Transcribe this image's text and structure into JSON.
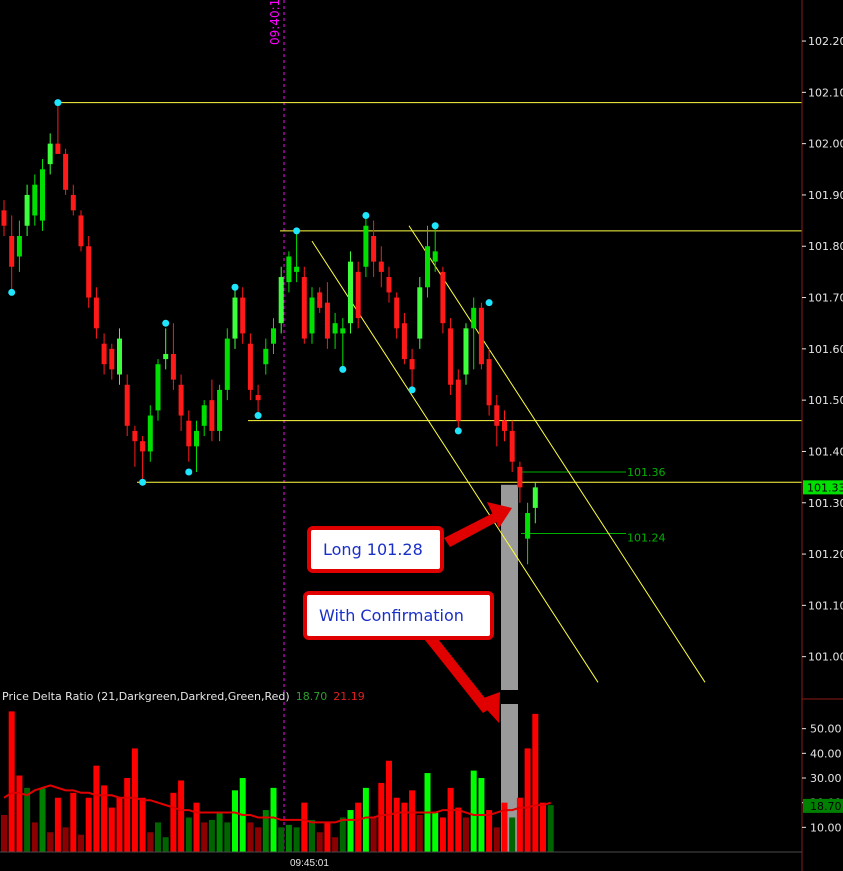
{
  "chart_data": {
    "type": "candlestick",
    "price_axis": {
      "range": [
        100.935,
        102.28
      ],
      "ticks": [
        "102.20",
        "102.10",
        "102.00",
        "101.90",
        "101.80",
        "101.70",
        "101.60",
        "101.50",
        "101.40",
        "101.30",
        "101.20",
        "101.10",
        "101.00"
      ],
      "current_price": "101.33"
    },
    "time_labels": {
      "marker": "09:40:1",
      "bottom": "09:45:01"
    },
    "horizontal_levels": [
      102.08,
      101.83,
      101.46,
      101.34
    ],
    "range_markers": {
      "upper": "101.36",
      "lower": "101.24",
      "upper_value": 101.36,
      "lower_value": 101.24
    },
    "candles": [
      {
        "o": 101.87,
        "h": 101.89,
        "l": 101.82,
        "c": 101.84,
        "d": "down"
      },
      {
        "o": 101.82,
        "h": 101.86,
        "l": 101.71,
        "c": 101.76,
        "d": "down"
      },
      {
        "o": 101.78,
        "h": 101.85,
        "l": 101.75,
        "c": 101.82,
        "d": "up"
      },
      {
        "o": 101.84,
        "h": 101.92,
        "l": 101.82,
        "c": 101.9,
        "d": "up"
      },
      {
        "o": 101.86,
        "h": 101.94,
        "l": 101.84,
        "c": 101.92,
        "d": "up"
      },
      {
        "o": 101.85,
        "h": 101.97,
        "l": 101.83,
        "c": 101.95,
        "d": "up"
      },
      {
        "o": 101.96,
        "h": 102.02,
        "l": 101.94,
        "c": 102.0,
        "d": "up"
      },
      {
        "o": 102.0,
        "h": 102.08,
        "l": 101.98,
        "c": 101.98,
        "d": "down"
      },
      {
        "o": 101.98,
        "h": 101.99,
        "l": 101.9,
        "c": 101.91,
        "d": "down"
      },
      {
        "o": 101.9,
        "h": 101.92,
        "l": 101.86,
        "c": 101.87,
        "d": "down"
      },
      {
        "o": 101.86,
        "h": 101.87,
        "l": 101.79,
        "c": 101.8,
        "d": "down"
      },
      {
        "o": 101.8,
        "h": 101.82,
        "l": 101.68,
        "c": 101.7,
        "d": "down"
      },
      {
        "o": 101.7,
        "h": 101.72,
        "l": 101.62,
        "c": 101.64,
        "d": "down"
      },
      {
        "o": 101.61,
        "h": 101.63,
        "l": 101.55,
        "c": 101.57,
        "d": "down"
      },
      {
        "o": 101.6,
        "h": 101.61,
        "l": 101.54,
        "c": 101.56,
        "d": "down"
      },
      {
        "o": 101.55,
        "h": 101.64,
        "l": 101.53,
        "c": 101.62,
        "d": "up"
      },
      {
        "o": 101.53,
        "h": 101.55,
        "l": 101.43,
        "c": 101.45,
        "d": "down"
      },
      {
        "o": 101.44,
        "h": 101.45,
        "l": 101.37,
        "c": 101.42,
        "d": "down"
      },
      {
        "o": 101.42,
        "h": 101.43,
        "l": 101.34,
        "c": 101.4,
        "d": "down"
      },
      {
        "o": 101.4,
        "h": 101.49,
        "l": 101.38,
        "c": 101.47,
        "d": "up"
      },
      {
        "o": 101.48,
        "h": 101.58,
        "l": 101.46,
        "c": 101.57,
        "d": "up"
      },
      {
        "o": 101.58,
        "h": 101.64,
        "l": 101.56,
        "c": 101.59,
        "d": "up"
      },
      {
        "o": 101.59,
        "h": 101.65,
        "l": 101.52,
        "c": 101.54,
        "d": "down"
      },
      {
        "o": 101.53,
        "h": 101.55,
        "l": 101.44,
        "c": 101.47,
        "d": "down"
      },
      {
        "o": 101.46,
        "h": 101.48,
        "l": 101.38,
        "c": 101.41,
        "d": "down"
      },
      {
        "o": 101.41,
        "h": 101.46,
        "l": 101.36,
        "c": 101.44,
        "d": "up"
      },
      {
        "o": 101.45,
        "h": 101.5,
        "l": 101.43,
        "c": 101.49,
        "d": "up"
      },
      {
        "o": 101.5,
        "h": 101.54,
        "l": 101.42,
        "c": 101.44,
        "d": "down"
      },
      {
        "o": 101.44,
        "h": 101.53,
        "l": 101.42,
        "c": 101.52,
        "d": "up"
      },
      {
        "o": 101.52,
        "h": 101.64,
        "l": 101.5,
        "c": 101.62,
        "d": "up"
      },
      {
        "o": 101.62,
        "h": 101.72,
        "l": 101.6,
        "c": 101.7,
        "d": "up"
      },
      {
        "o": 101.7,
        "h": 101.72,
        "l": 101.61,
        "c": 101.63,
        "d": "down"
      },
      {
        "o": 101.61,
        "h": 101.63,
        "l": 101.5,
        "c": 101.52,
        "d": "down"
      },
      {
        "o": 101.51,
        "h": 101.53,
        "l": 101.47,
        "c": 101.5,
        "d": "down"
      },
      {
        "o": 101.57,
        "h": 101.62,
        "l": 101.55,
        "c": 101.6,
        "d": "up"
      },
      {
        "o": 101.61,
        "h": 101.66,
        "l": 101.59,
        "c": 101.64,
        "d": "up"
      },
      {
        "o": 101.65,
        "h": 101.76,
        "l": 101.63,
        "c": 101.74,
        "d": "up"
      },
      {
        "o": 101.73,
        "h": 101.79,
        "l": 101.71,
        "c": 101.78,
        "d": "up"
      },
      {
        "o": 101.76,
        "h": 101.83,
        "l": 101.73,
        "c": 101.75,
        "d": "up"
      },
      {
        "o": 101.74,
        "h": 101.76,
        "l": 101.61,
        "c": 101.62,
        "d": "down"
      },
      {
        "o": 101.63,
        "h": 101.72,
        "l": 101.61,
        "c": 101.7,
        "d": "up"
      },
      {
        "o": 101.71,
        "h": 101.72,
        "l": 101.67,
        "c": 101.68,
        "d": "down"
      },
      {
        "o": 101.69,
        "h": 101.73,
        "l": 101.6,
        "c": 101.62,
        "d": "down"
      },
      {
        "o": 101.63,
        "h": 101.67,
        "l": 101.6,
        "c": 101.65,
        "d": "up"
      },
      {
        "o": 101.64,
        "h": 101.66,
        "l": 101.56,
        "c": 101.63,
        "d": "up"
      },
      {
        "o": 101.65,
        "h": 101.79,
        "l": 101.63,
        "c": 101.77,
        "d": "up"
      },
      {
        "o": 101.75,
        "h": 101.77,
        "l": 101.64,
        "c": 101.66,
        "d": "down"
      },
      {
        "o": 101.76,
        "h": 101.86,
        "l": 101.74,
        "c": 101.84,
        "d": "up"
      },
      {
        "o": 101.82,
        "h": 101.85,
        "l": 101.74,
        "c": 101.77,
        "d": "down"
      },
      {
        "o": 101.77,
        "h": 101.8,
        "l": 101.72,
        "c": 101.75,
        "d": "down"
      },
      {
        "o": 101.74,
        "h": 101.76,
        "l": 101.69,
        "c": 101.71,
        "d": "down"
      },
      {
        "o": 101.7,
        "h": 101.71,
        "l": 101.62,
        "c": 101.64,
        "d": "down"
      },
      {
        "o": 101.65,
        "h": 101.67,
        "l": 101.57,
        "c": 101.58,
        "d": "down"
      },
      {
        "o": 101.58,
        "h": 101.6,
        "l": 101.52,
        "c": 101.56,
        "d": "down"
      },
      {
        "o": 101.62,
        "h": 101.74,
        "l": 101.6,
        "c": 101.72,
        "d": "up"
      },
      {
        "o": 101.72,
        "h": 101.84,
        "l": 101.7,
        "c": 101.8,
        "d": "up"
      },
      {
        "o": 101.77,
        "h": 101.84,
        "l": 101.75,
        "c": 101.79,
        "d": "up"
      },
      {
        "o": 101.75,
        "h": 101.76,
        "l": 101.63,
        "c": 101.65,
        "d": "down"
      },
      {
        "o": 101.64,
        "h": 101.66,
        "l": 101.51,
        "c": 101.53,
        "d": "down"
      },
      {
        "o": 101.54,
        "h": 101.56,
        "l": 101.44,
        "c": 101.46,
        "d": "down"
      },
      {
        "o": 101.55,
        "h": 101.65,
        "l": 101.53,
        "c": 101.64,
        "d": "up"
      },
      {
        "o": 101.64,
        "h": 101.7,
        "l": 101.56,
        "c": 101.68,
        "d": "up"
      },
      {
        "o": 101.68,
        "h": 101.69,
        "l": 101.56,
        "c": 101.57,
        "d": "down"
      },
      {
        "o": 101.58,
        "h": 101.6,
        "l": 101.47,
        "c": 101.49,
        "d": "down"
      },
      {
        "o": 101.49,
        "h": 101.51,
        "l": 101.41,
        "c": 101.45,
        "d": "down"
      },
      {
        "o": 101.46,
        "h": 101.48,
        "l": 101.42,
        "c": 101.44,
        "d": "down"
      },
      {
        "o": 101.44,
        "h": 101.46,
        "l": 101.36,
        "c": 101.38,
        "d": "down"
      },
      {
        "o": 101.37,
        "h": 101.38,
        "l": 101.3,
        "c": 101.33,
        "d": "down"
      },
      {
        "o": 101.23,
        "h": 101.3,
        "l": 101.18,
        "c": 101.28,
        "d": "up"
      },
      {
        "o": 101.29,
        "h": 101.34,
        "l": 101.26,
        "c": 101.33,
        "d": "up"
      }
    ],
    "swing_points": [
      {
        "i": 1,
        "v": 101.71
      },
      {
        "i": 7,
        "v": 102.08
      },
      {
        "i": 18,
        "v": 101.34
      },
      {
        "i": 21,
        "v": 101.65
      },
      {
        "i": 24,
        "v": 101.36
      },
      {
        "i": 30,
        "v": 101.72
      },
      {
        "i": 33,
        "v": 101.47
      },
      {
        "i": 38,
        "v": 101.83
      },
      {
        "i": 44,
        "v": 101.56
      },
      {
        "i": 47,
        "v": 101.86
      },
      {
        "i": 53,
        "v": 101.52
      },
      {
        "i": 56,
        "v": 101.84
      },
      {
        "i": 59,
        "v": 101.44
      },
      {
        "i": 63,
        "v": 101.69
      }
    ],
    "indicator": {
      "title": "Price Delta Ratio (21,Darkgreen,Darkred,Green,Red)",
      "value_green": "18.70",
      "value_red": "21.19",
      "axis_ticks": [
        "50.00",
        "40.00",
        "30.00",
        "20.00",
        "10.00"
      ],
      "axis_range": [
        0,
        60
      ],
      "current_label": "18.70",
      "bars": [
        {
          "v": 15,
          "c": "#8b0000"
        },
        {
          "v": 57,
          "c": "#ff0000"
        },
        {
          "v": 31,
          "c": "#ff0000"
        },
        {
          "v": 26,
          "c": "#006400"
        },
        {
          "v": 12,
          "c": "#8b0000"
        },
        {
          "v": 26,
          "c": "#008000"
        },
        {
          "v": 8,
          "c": "#8b0000"
        },
        {
          "v": 22,
          "c": "#ff0000"
        },
        {
          "v": 10,
          "c": "#8b0000"
        },
        {
          "v": 24,
          "c": "#ff0000"
        },
        {
          "v": 7,
          "c": "#8b0000"
        },
        {
          "v": 22,
          "c": "#ff0000"
        },
        {
          "v": 35,
          "c": "#ff0000"
        },
        {
          "v": 27,
          "c": "#ff0000"
        },
        {
          "v": 18,
          "c": "#ff0000"
        },
        {
          "v": 22,
          "c": "#ff0000"
        },
        {
          "v": 30,
          "c": "#ff0000"
        },
        {
          "v": 42,
          "c": "#ff0000"
        },
        {
          "v": 22,
          "c": "#ff0000"
        },
        {
          "v": 8,
          "c": "#8b0000"
        },
        {
          "v": 12,
          "c": "#006400"
        },
        {
          "v": 6,
          "c": "#006400"
        },
        {
          "v": 24,
          "c": "#ff0000"
        },
        {
          "v": 29,
          "c": "#ff0000"
        },
        {
          "v": 14,
          "c": "#006400"
        },
        {
          "v": 20,
          "c": "#ff0000"
        },
        {
          "v": 12,
          "c": "#8b0000"
        },
        {
          "v": 13,
          "c": "#006400"
        },
        {
          "v": 16,
          "c": "#008000"
        },
        {
          "v": 12,
          "c": "#006400"
        },
        {
          "v": 25,
          "c": "#00ff00"
        },
        {
          "v": 30,
          "c": "#00ff00"
        },
        {
          "v": 12,
          "c": "#8b0000"
        },
        {
          "v": 10,
          "c": "#8b0000"
        },
        {
          "v": 17,
          "c": "#008000"
        },
        {
          "v": 26,
          "c": "#00ff00"
        },
        {
          "v": 10,
          "c": "#006400"
        },
        {
          "v": 11,
          "c": "#008000"
        },
        {
          "v": 10,
          "c": "#006400"
        },
        {
          "v": 20,
          "c": "#ff0000"
        },
        {
          "v": 13,
          "c": "#006400"
        },
        {
          "v": 8,
          "c": "#8b0000"
        },
        {
          "v": 12,
          "c": "#ff0000"
        },
        {
          "v": 6,
          "c": "#8b0000"
        },
        {
          "v": 14,
          "c": "#006400"
        },
        {
          "v": 17,
          "c": "#00ff00"
        },
        {
          "v": 20,
          "c": "#ff0000"
        },
        {
          "v": 26,
          "c": "#00ff00"
        },
        {
          "v": 14,
          "c": "#8b0000"
        },
        {
          "v": 28,
          "c": "#ff0000"
        },
        {
          "v": 37,
          "c": "#ff0000"
        },
        {
          "v": 22,
          "c": "#ff0000"
        },
        {
          "v": 20,
          "c": "#ff0000"
        },
        {
          "v": 25,
          "c": "#ff0000"
        },
        {
          "v": 15,
          "c": "#8b0000"
        },
        {
          "v": 32,
          "c": "#00ff00"
        },
        {
          "v": 16,
          "c": "#00ff00"
        },
        {
          "v": 14,
          "c": "#ff0000"
        },
        {
          "v": 26,
          "c": "#ff0000"
        },
        {
          "v": 18,
          "c": "#ff0000"
        },
        {
          "v": 14,
          "c": "#8b0000"
        },
        {
          "v": 33,
          "c": "#00ff00"
        },
        {
          "v": 30,
          "c": "#00ff00"
        },
        {
          "v": 17,
          "c": "#ff0000"
        },
        {
          "v": 10,
          "c": "#8b0000"
        },
        {
          "v": 20,
          "c": "#ff0000"
        },
        {
          "v": 14,
          "c": "#006400"
        },
        {
          "v": 22,
          "c": "#ff0000"
        },
        {
          "v": 42,
          "c": "#ff0000"
        },
        {
          "v": 56,
          "c": "#ff0000"
        },
        {
          "v": 20,
          "c": "#ff0000"
        },
        {
          "v": 19,
          "c": "#006400"
        }
      ],
      "ratio_line": [
        22,
        24,
        24,
        23,
        25,
        26,
        27,
        26,
        25,
        25,
        24,
        24,
        23,
        23,
        23,
        22,
        22,
        22,
        21,
        21,
        20,
        19,
        18,
        17,
        17,
        16,
        16,
        16,
        16,
        16,
        16,
        15,
        15,
        14,
        14,
        14,
        13,
        13,
        13,
        13,
        12,
        12,
        12,
        12,
        13,
        13,
        13,
        14,
        14,
        15,
        15,
        16,
        16,
        16,
        16,
        16,
        16,
        17,
        17,
        17,
        16,
        15,
        15,
        15,
        16,
        17,
        17,
        18,
        18,
        19,
        19,
        20
      ]
    },
    "annotations": {
      "long_label": "Long 101.28",
      "confirm_label": "With Confirmation"
    },
    "colors": {
      "up": "#00e000",
      "up_bright": "#3cff3c",
      "down": "#ff1a1a",
      "level": "#ffff40",
      "swing": "#1ee6ff",
      "time_marker": "#ff00ff",
      "range": "#00b000",
      "highlight": "#b5b5b5",
      "axis_text": "#e6e6e6",
      "axis_line": "#8b1a1a",
      "callout_border": "#e00000",
      "callout_text": "#1a2fc8"
    }
  }
}
